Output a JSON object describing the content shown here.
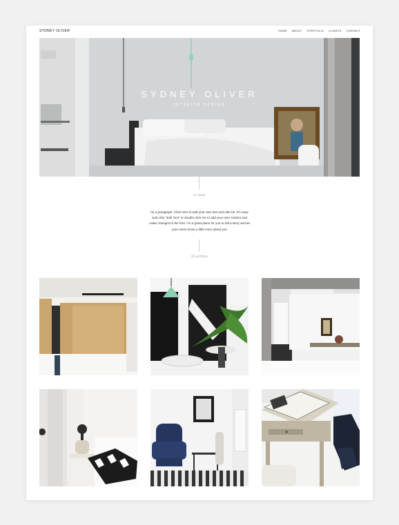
{
  "site": {
    "logo": "SYDNEY OLIVER"
  },
  "nav": {
    "items": [
      "HOME",
      "ABOUT",
      "PORTFOLIO",
      "CLIENTS",
      "CONTACT"
    ]
  },
  "hero": {
    "title": "SYDNEY OLIVER",
    "subtitle": "INTERIOR DESIGN"
  },
  "about": {
    "label": "01 about",
    "text": "I'm a paragraph. Click here to add your own text and edit me. It's easy. Just click “Edit Text” or double click me to add your own content and make changes to the font. I'm a great place for you to tell a story and let your users know a little more about you"
  },
  "portfolio": {
    "label": "02 portfolio",
    "items": [
      "wood-paneled-bedroom",
      "dining-room-with-palm",
      "white-kitchen-concrete-ceiling",
      "bedroom-with-lamps",
      "blue-armchair-corner",
      "vintage-desk-with-book"
    ]
  },
  "colors": {
    "page_bg": "#f1f1f1",
    "canvas_bg": "#ffffff",
    "text": "#333333",
    "muted_label": "#9a9a9a"
  }
}
